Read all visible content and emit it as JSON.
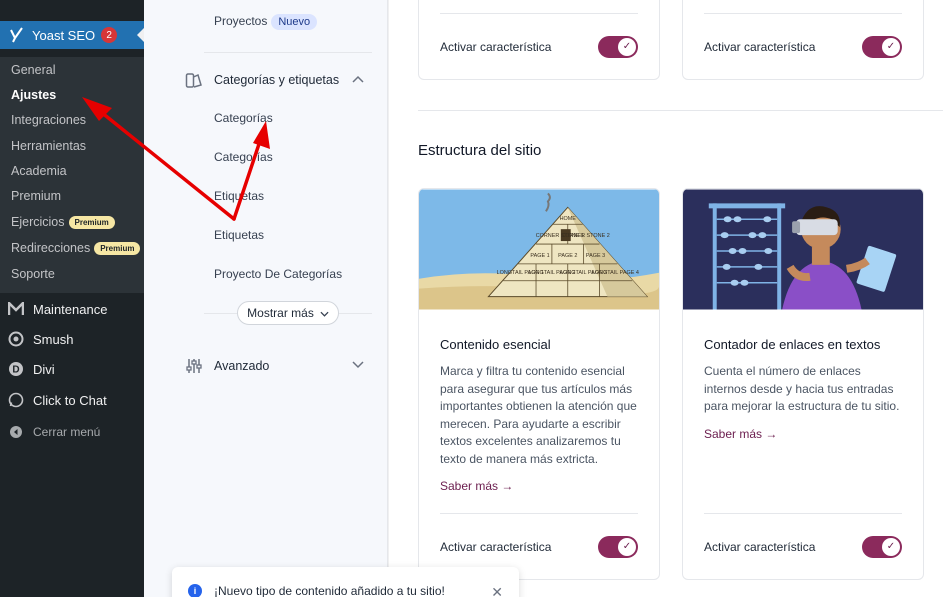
{
  "wp_menu": {
    "yoast": {
      "label": "Yoast SEO",
      "badge": "2"
    },
    "submenu": [
      {
        "label": "General"
      },
      {
        "label": "Ajustes"
      },
      {
        "label": "Integraciones"
      },
      {
        "label": "Herramientas"
      },
      {
        "label": "Academia"
      },
      {
        "label": "Premium"
      },
      {
        "label": "Ejercicios",
        "pill": "Premium"
      },
      {
        "label": "Redirecciones",
        "pill": "Premium"
      },
      {
        "label": "Soporte"
      }
    ],
    "items": [
      {
        "label": "Maintenance",
        "icon": "maintenance-icon"
      },
      {
        "label": "Smush",
        "icon": "smush-icon"
      },
      {
        "label": "Divi",
        "icon": "divi-icon"
      },
      {
        "label": "Click to Chat",
        "icon": "whatsapp-icon"
      }
    ],
    "collapse": "Cerrar menú"
  },
  "settings_nav": {
    "proyectos": {
      "label": "Proyectos",
      "badge": "Nuevo"
    },
    "categorias_group": {
      "label": "Categorías y etiquetas"
    },
    "links": [
      "Categorías",
      "Categorías",
      "Etiquetas",
      "Etiquetas",
      "Proyecto De Categorías"
    ],
    "mostrar_mas": "Mostrar más",
    "avanzado": {
      "label": "Avanzado"
    }
  },
  "content": {
    "top_cards": [
      {
        "toggle_label": "Activar característica"
      },
      {
        "toggle_label": "Activar característica"
      }
    ],
    "section_title": "Estructura del sitio",
    "cards": [
      {
        "title": "Contenido esencial",
        "description": "Marca y filtra tu contenido esencial para asegurar que tus artículos más importantes obtienen la atención que merecen. Para ayudarte a escribir textos excelentes analizaremos tu texto de manera más extricta.",
        "more": "Saber más →",
        "toggle_label": "Activar característica",
        "illustration_labels": [
          "HOME",
          "CORNER STONE 1",
          "CORNER STONE 2",
          "PAGE 1",
          "PAGE 2",
          "PAGE 3",
          "LONGTAIL PAGE 1",
          "LONGTAIL PAGE 2",
          "LONGTAIL PAGE 3",
          "LONGTAIL PAGE 4"
        ]
      },
      {
        "title": "Contador de enlaces en textos",
        "description": "Cuenta el número de enlaces internos desde y hacia tus entradas para mejorar la estructura de tu sitio.",
        "more": "Saber más →",
        "toggle_label": "Activar característica"
      }
    ]
  },
  "toast": {
    "message": "¡Nuevo tipo de contenido añadido a tu sitio!"
  },
  "colors": {
    "wp_dark": "#1d2327",
    "wp_blue": "#2271b1",
    "yoast_purple": "#8b2a5c",
    "annotation_red": "#e60000"
  }
}
